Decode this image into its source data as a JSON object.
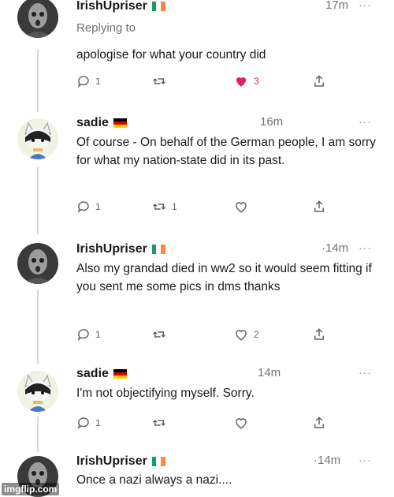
{
  "colors": {
    "accent_like": "#e0245e",
    "secondary_text": "#6d7479",
    "ireland_flag": [
      "#169b62",
      "#ffffff",
      "#ff883e"
    ],
    "germany_flag": [
      "#000000",
      "#dd0000",
      "#ffce00"
    ]
  },
  "tweets": [
    {
      "user": "IrishUpriser",
      "flag": "ireland",
      "time": "17m",
      "more": "···",
      "replying": "Replying to",
      "text": "apologise for what your country did",
      "reply_count": "1",
      "retweet_count": "",
      "like_count": "3",
      "liked": true
    },
    {
      "user": "sadie",
      "flag": "germany",
      "time": "16m",
      "more": "···",
      "text": "Of course - On behalf of the German people, I am sorry for what my nation-state did in its past.",
      "reply_count": "1",
      "retweet_count": "1",
      "like_count": "",
      "liked": false
    },
    {
      "user": "IrishUpriser",
      "flag": "ireland",
      "time": "·14m",
      "more": "···",
      "text": "Also my grandad died in ww2 so it would seem fitting if you sent me some pics in dms thanks",
      "reply_count": "1",
      "retweet_count": "",
      "like_count": "2",
      "liked": false
    },
    {
      "user": "sadie",
      "flag": "germany",
      "time": "14m",
      "more": "···",
      "text": "I'm not objectifying myself. Sorry.",
      "reply_count": "1",
      "retweet_count": "",
      "like_count": "",
      "liked": false
    },
    {
      "user": "IrishUpriser",
      "flag": "ireland",
      "time": "·14m",
      "more": "···",
      "text": "Once a nazi always a nazi....",
      "reply_count": "",
      "retweet_count": "",
      "like_count": "",
      "liked": false
    }
  ],
  "watermark": "imgflip.com",
  "icons": {
    "reply": "reply-icon",
    "retweet": "retweet-icon",
    "like": "heart-icon",
    "share": "share-icon",
    "more": "more-icon"
  }
}
